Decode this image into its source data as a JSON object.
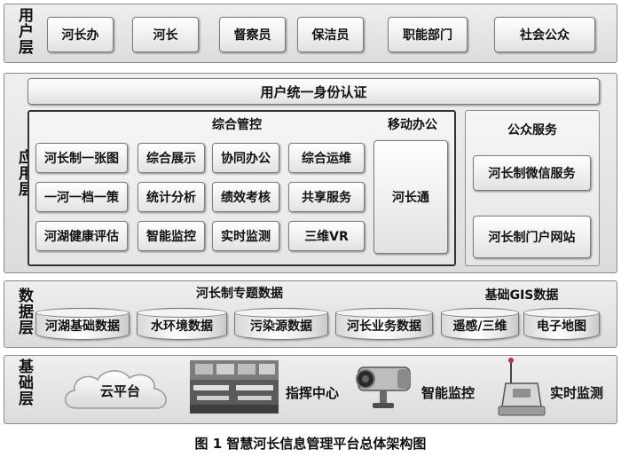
{
  "user_layer": {
    "label": "用户层",
    "items": [
      "河长办",
      "河长",
      "督察员",
      "保洁员",
      "职能部门",
      "社会公众"
    ]
  },
  "app_layer": {
    "label": "应用层",
    "auth_bar": "用户统一身份认证",
    "integrated_control": {
      "title": "综合管控",
      "buttons": [
        "河长制一张图",
        "综合展示",
        "协同办公",
        "综合运维",
        "一河一档一策",
        "统计分析",
        "绩效考核",
        "共享服务",
        "河湖健康评估",
        "智能监控",
        "实时监测",
        "三维VR"
      ]
    },
    "mobile_office": {
      "title": "移动办公",
      "item": "河长通"
    },
    "public_service": {
      "title": "公众服务",
      "items": [
        "河长制微信服务",
        "河长制门户网站"
      ]
    }
  },
  "data_layer": {
    "label": "数据层",
    "thematic_title": "河长制专题数据",
    "thematic_items": [
      "河湖基础数据",
      "水环境数据",
      "污染源数据",
      "河长业务数据"
    ],
    "gis_title": "基础GIS数据",
    "gis_items": [
      "遥感/三维",
      "电子地图"
    ]
  },
  "infra_layer": {
    "label": "基础层",
    "items": [
      "云平台",
      "指挥中心",
      "智能监控",
      "实时监测"
    ]
  },
  "caption": "图 1  智慧河长信息管理平台总体架构图"
}
